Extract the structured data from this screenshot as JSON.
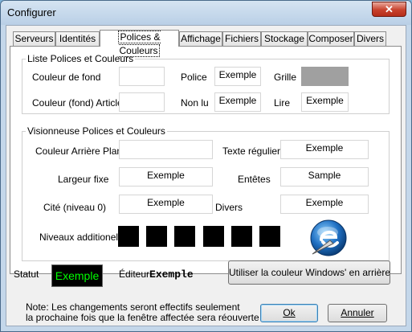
{
  "window": {
    "title": "Configurer",
    "close_glyph": "✕"
  },
  "tabs": [
    "Serveurs",
    "Identités",
    "Polices & Couleurs",
    "Affichage",
    "Fichiers",
    "Stockage",
    "Composer",
    "Divers"
  ],
  "liste": {
    "title": "Liste Polices et Couleurs",
    "couleur_fond": "Couleur de fond",
    "couleur_articles": "Couleur (fond) Articles",
    "police": "Police",
    "police_sample": "Exemple",
    "non_lu": "Non lu",
    "non_lu_sample": "Exemple",
    "grille": "Grille",
    "lire": "Lire",
    "lire_sample": "Exemple",
    "grille_color": "#a0a0a0"
  },
  "viewer": {
    "title": "Visionneuse Polices et Couleurs",
    "arriere_plan": "Couleur Arrière Plan",
    "texte_regulier": "Texte régulier",
    "texte_regulier_sample": "Exemple",
    "largeur_fixe": "Largeur fixe",
    "largeur_fixe_sample": "Exemple",
    "entetes": "Entêtes",
    "entetes_sample": "Sample",
    "cite": "Cité (niveau 0)",
    "cite_sample": "Exemple",
    "divers": "Divers",
    "divers_sample": "Exemple",
    "niveaux": "Niveaux additionels"
  },
  "statut": {
    "label": "Statut",
    "sample": "Exemple",
    "text_color": "#00ff00",
    "bg_color": "#000000"
  },
  "editeur": {
    "label": "Éditeur",
    "sample": "Exemple"
  },
  "windows_color_button": "Utiliser la couleur Windows' en arrière plan",
  "note": {
    "line1": "Note: Les changements seront effectifs seulement",
    "line2": "la prochaine fois que la fenêtre affectée sera réouverte"
  },
  "ok_label": "Ok",
  "cancel_label": "Annuler"
}
